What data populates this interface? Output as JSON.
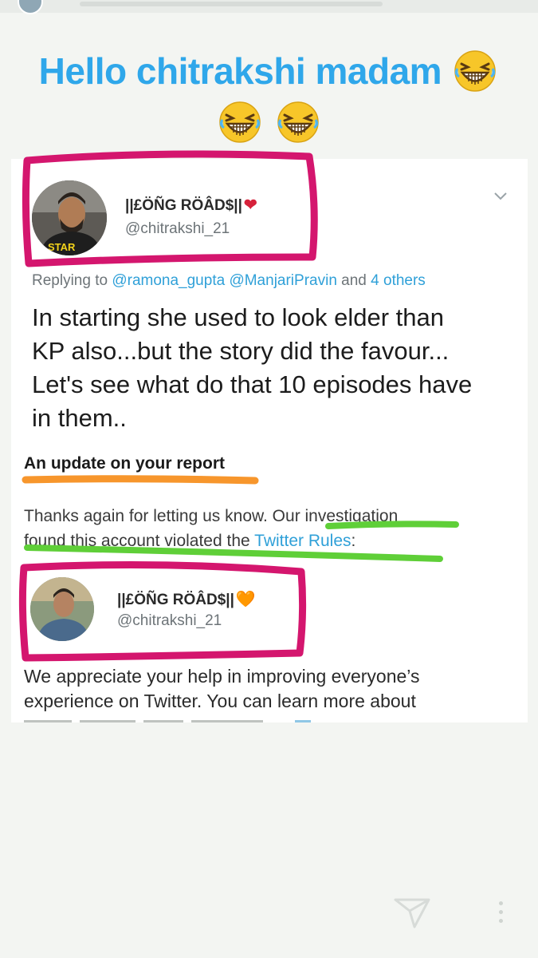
{
  "headline": {
    "text": "Hello chitrakshi madam",
    "emoji_icon": "grinning-squinting-face-icon"
  },
  "tweet1": {
    "name": "||£ÖÑG RÖÂD$||",
    "name_emoji": "❤",
    "handle": "@chitrakshi_21",
    "reply_prefix": "Replying to ",
    "reply_mentions": "@ramona_gupta @ManjariPravin",
    "reply_suffix_and": " and ",
    "reply_others": "4 others",
    "body_lines": [
      "In starting she used to look elder than",
      "KP also...but the story did the favour...",
      "Let's see what do that 10 episodes have",
      "in them.."
    ]
  },
  "report": {
    "heading": "An update on your report",
    "line1": "Thanks again for letting us know. Our investigation",
    "line2_start": "found this account violated the ",
    "line2_link": "Twitter Rules",
    "line2_end": ":"
  },
  "tweet2": {
    "name": "||£ÖÑG RÖÂD$||",
    "name_emoji": "🧡",
    "handle": "@chitrakshi_21"
  },
  "appreciate": {
    "line1": "We appreciate your help in improving everyone’s",
    "line2": "experience on Twitter. You can learn more about"
  },
  "colors": {
    "accent_blue": "#2fa7ea",
    "annotation_pink": "#d4166e",
    "annotation_orange": "#f7962c",
    "annotation_green": "#5fcf38"
  }
}
